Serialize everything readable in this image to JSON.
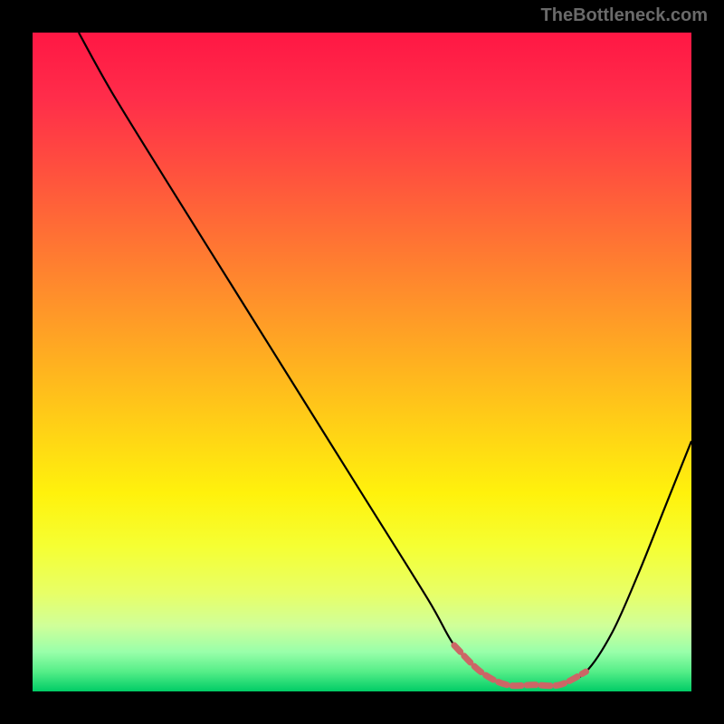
{
  "attribution": "TheBottleneck.com",
  "chart_data": {
    "type": "line",
    "title": "",
    "xlabel": "",
    "ylabel": "",
    "xlim": [
      0,
      100
    ],
    "ylim": [
      0,
      100
    ],
    "series": [
      {
        "name": "bottleneck-curve",
        "color": "#000000",
        "x": [
          7,
          12,
          20,
          30,
          40,
          50,
          60,
          64,
          68,
          72,
          76,
          80,
          84,
          88,
          92,
          96,
          100
        ],
        "y": [
          100,
          91,
          78,
          62,
          46,
          30,
          14,
          7,
          3,
          1,
          1,
          1,
          3,
          9,
          18,
          28,
          38
        ]
      },
      {
        "name": "optimal-zone-marker",
        "color": "#cc6666",
        "x": [
          64,
          68,
          72,
          76,
          80,
          84
        ],
        "y": [
          7,
          3,
          1,
          1,
          1,
          3
        ]
      }
    ],
    "gradient_stops": [
      {
        "offset": 0.0,
        "color": "#ff1744"
      },
      {
        "offset": 0.1,
        "color": "#ff2d4a"
      },
      {
        "offset": 0.2,
        "color": "#ff4d3f"
      },
      {
        "offset": 0.3,
        "color": "#ff6e35"
      },
      {
        "offset": 0.4,
        "color": "#ff8f2b"
      },
      {
        "offset": 0.5,
        "color": "#ffb020"
      },
      {
        "offset": 0.6,
        "color": "#ffd116"
      },
      {
        "offset": 0.7,
        "color": "#fff20c"
      },
      {
        "offset": 0.78,
        "color": "#f5ff33"
      },
      {
        "offset": 0.85,
        "color": "#e8ff66"
      },
      {
        "offset": 0.9,
        "color": "#d0ff99"
      },
      {
        "offset": 0.94,
        "color": "#99ffaa"
      },
      {
        "offset": 0.97,
        "color": "#55ee88"
      },
      {
        "offset": 1.0,
        "color": "#00cc66"
      }
    ]
  }
}
